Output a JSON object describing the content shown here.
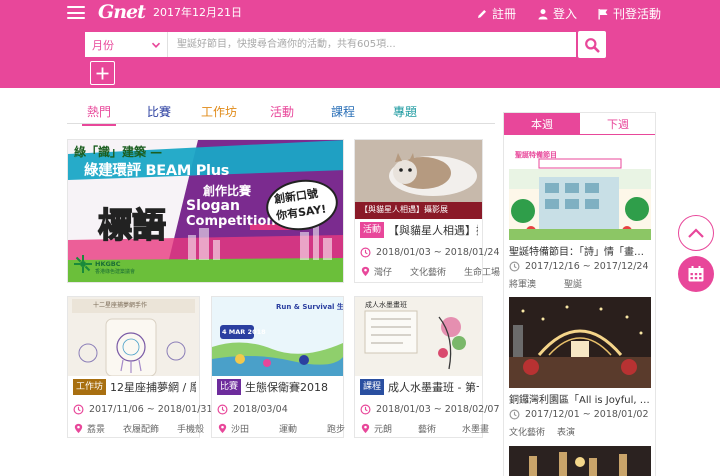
{
  "colors": {
    "brand": "#e8479a",
    "hot": "#e8479a",
    "competition": "#2b3fa0",
    "workshop": "#e08a17",
    "activity": "#e8479a",
    "course": "#2a6fb7",
    "topic": "#1c9aa0",
    "badge_workshop": "#a86f10",
    "badge_competition": "#6d2c9c",
    "badge_course": "#2a4fa0",
    "badge_activity": "#e8479a",
    "meta_icon": "#e8479a"
  },
  "header": {
    "logo": "Gnet",
    "date": "2017年12月21日",
    "register": "註冊",
    "login": "登入",
    "post_event": "刊登活動",
    "icons": {
      "menu": "hamburger-menu-icon",
      "register": "pencil-icon",
      "login": "user-icon",
      "post": "flag-icon",
      "search": "magnifier-icon",
      "add": "plus-icon"
    }
  },
  "search": {
    "month_label": "月份",
    "placeholder": "聖誕好節目，快搜尋合適你的活動，共有605項..."
  },
  "tabs": [
    "熱門",
    "比賽",
    "工作坊",
    "活動",
    "課程",
    "專題"
  ],
  "feature": {
    "banner": {
      "line1": "綠「識」建築 —",
      "line2": "綠建環評 BEAM Plus",
      "line3": "創作比賽",
      "line4": "Slogan",
      "line5": "Competition",
      "big": "標語",
      "bubble1": "創新口號",
      "bubble2": "你有SAY!",
      "org": "HKGBC",
      "org_sub": "香港綠色建築議會"
    }
  },
  "cards": [
    {
      "title": "【與貓星人相遇】攝...",
      "badge": "活動",
      "date": "2018/01/03 ~ 2018/01/24",
      "tags": [
        "灣仔",
        "文化藝術",
        "生命工場"
      ],
      "thumb": {
        "caption": "【與貓星人相遇】攝影展"
      }
    },
    {
      "title": "12星座捕夢網 / 摩天...",
      "badge": "工作坊",
      "date": "2017/11/06 ~ 2018/01/31",
      "tags": [
        "荔景",
        "衣履配飾",
        "手機殼"
      ],
      "thumb": {
        "caption": "十二星座捕夢網手作"
      }
    },
    {
      "title": "生態保衛賽2018",
      "badge": "比賽",
      "date": "2018/03/04",
      "tags": [
        "沙田",
        "運動",
        "跑步"
      ],
      "thumb": {
        "caption": "Run & Survival 生態保衛賽",
        "date": "4 MAR 2018"
      }
    },
    {
      "title": "成人水墨畫班 - 第十期",
      "badge": "課程",
      "date": "2018/01/03 ~ 2018/02/07",
      "tags": [
        "元朗",
        "藝術",
        "水墨畫"
      ],
      "thumb": {
        "caption": "成人水墨畫班"
      }
    }
  ],
  "sidebar": {
    "tabs": [
      "本週",
      "下週"
    ],
    "items": [
      {
        "title": "聖誕特備節目：「詩」情「畫」意...",
        "date": "2017/12/16 ~ 2017/12/24",
        "tags": [
          "將軍澳",
          "聖誕"
        ],
        "thumb": {
          "caption": "聖誕特備節目"
        }
      },
      {
        "title": "銅鑼灣利園區「All is Joyful, All...",
        "date": "2017/12/01 ~ 2018/01/02",
        "tags": [
          "文化藝術",
          "表演"
        ]
      },
      {
        "title": "",
        "date": "",
        "tags": []
      }
    ]
  },
  "floating": {
    "scroll_top": "chevron-up-icon",
    "calendar": "calendar-icon"
  }
}
